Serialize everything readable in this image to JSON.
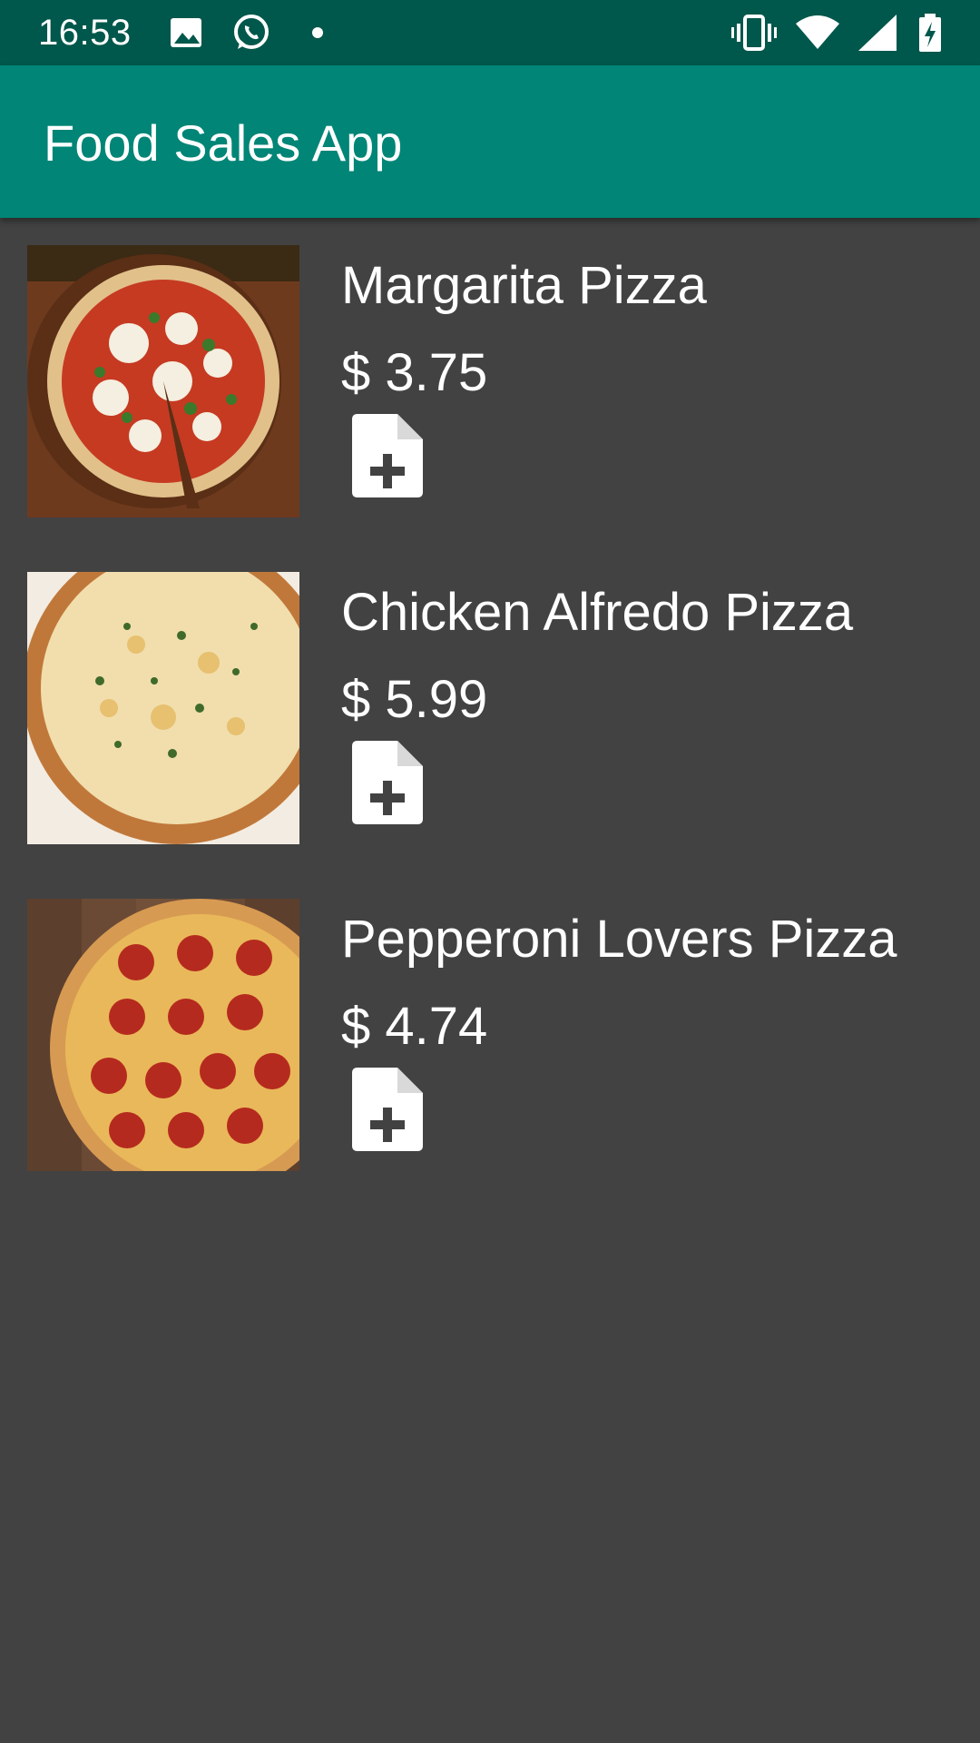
{
  "status_bar": {
    "time": "16:53",
    "left_icons": [
      "image-icon",
      "whatsapp-icon",
      "dot-icon"
    ],
    "right_icons": [
      "vibrate-icon",
      "wifi-icon",
      "signal-icon",
      "battery-charging-icon"
    ]
  },
  "app_bar": {
    "title": "Food Sales App"
  },
  "items": [
    {
      "name": "Margarita Pizza",
      "price": "$ 3.75",
      "image": "margarita-pizza-photo",
      "action_icon": "add-document-icon"
    },
    {
      "name": "Chicken Alfredo Pizza",
      "price": "$ 5.99",
      "image": "chicken-alfredo-pizza-photo",
      "action_icon": "add-document-icon"
    },
    {
      "name": "Pepperoni Lovers Pizza",
      "price": "$ 4.74",
      "image": "pepperoni-pizza-photo",
      "action_icon": "add-document-icon"
    }
  ],
  "colors": {
    "status_bar": "#00574b",
    "app_bar": "#008577",
    "background": "#424242",
    "text": "#ffffff"
  }
}
